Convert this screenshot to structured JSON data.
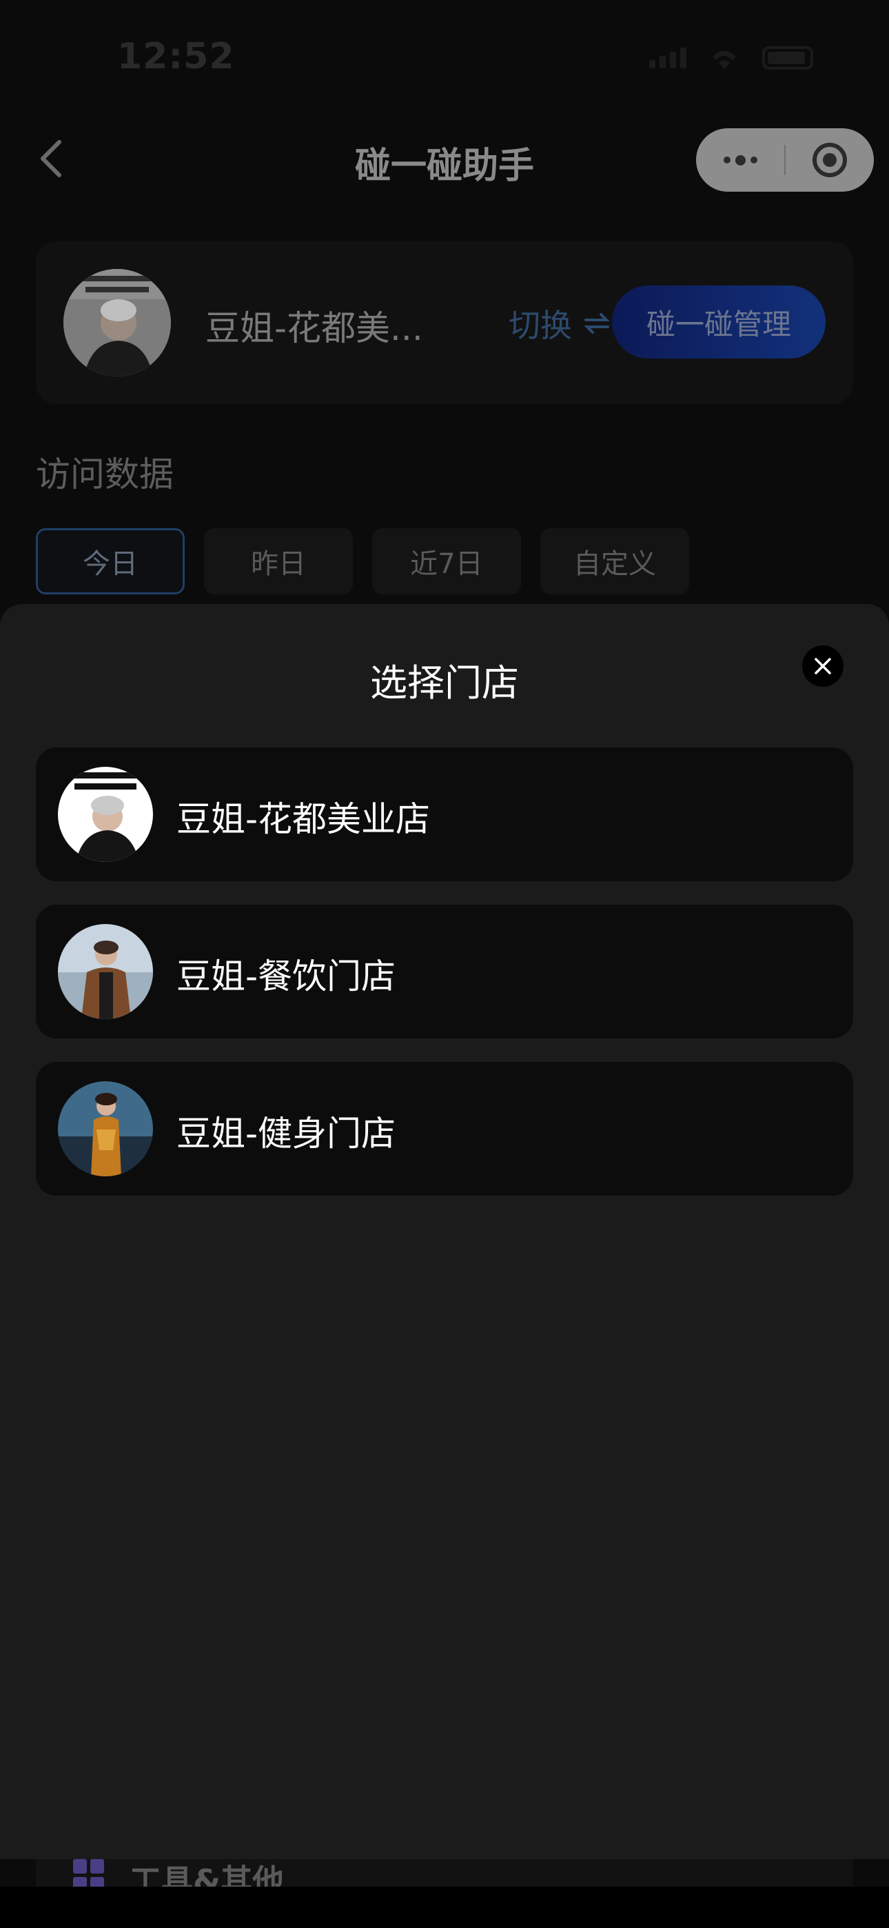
{
  "status_bar": {
    "time": "12:52"
  },
  "nav": {
    "title": "碰一碰助手"
  },
  "current_store": {
    "name": "豆姐-花都美...",
    "switch_label": "切换",
    "manage_label": "碰一碰管理"
  },
  "visit_data": {
    "title": "访问数据",
    "tabs": [
      {
        "label": "今日",
        "active": true
      },
      {
        "label": "昨日",
        "active": false
      },
      {
        "label": "近7日",
        "active": false
      },
      {
        "label": "自定义",
        "active": false
      }
    ]
  },
  "store_picker": {
    "title": "选择门店",
    "stores": [
      {
        "name": "豆姐-花都美业店"
      },
      {
        "name": "豆姐-餐饮门店"
      },
      {
        "name": "豆姐-健身门店"
      }
    ]
  },
  "bottom_section": {
    "label": "工具&其他"
  },
  "colors": {
    "sheet_bg": "#1b1b1b",
    "item_bg": "#0c0c0c",
    "accent_blue": "#12317a"
  }
}
